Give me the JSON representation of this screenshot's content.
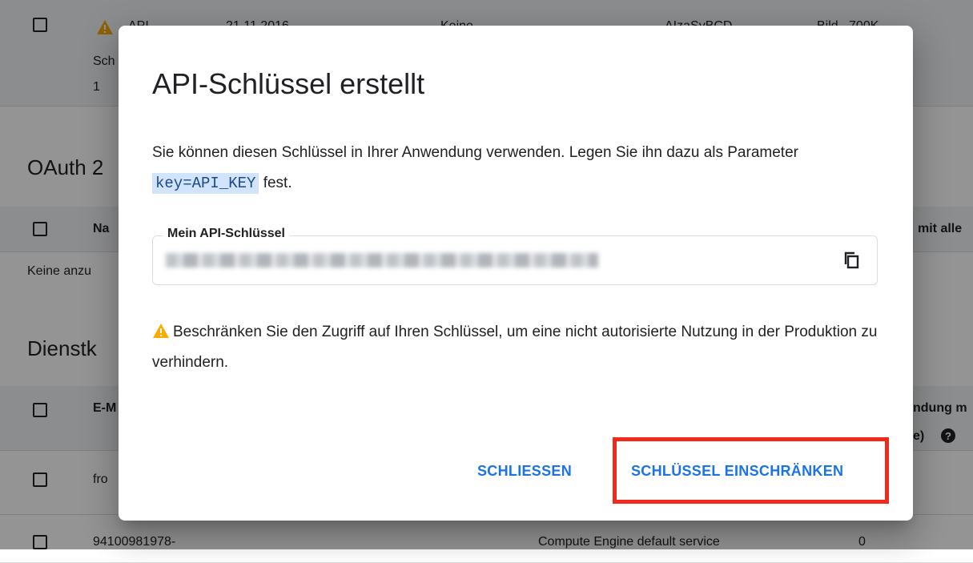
{
  "background": {
    "row1": {
      "col_name_top": "API-",
      "col_name_mid": "Sch",
      "col_name_bot": "1",
      "col_date": "21.11.2016",
      "col_restr": "Keine",
      "col_key": "AIzaSyBCD...",
      "col_tail": "Bild...700K"
    },
    "oauth_heading": "OAuth 2",
    "oauth_header": "Na",
    "oauth_header_right": "mit alle",
    "oauth_empty": "Keine anzu",
    "service_heading": "Dienstk",
    "service_header": "E-M",
    "service_header_right1": "ndung m",
    "service_header_right2": "e)",
    "service_row1": "fro",
    "service_row2_id": "94100981978-",
    "service_row2_name": "Compute Engine default service",
    "service_row2_count": "0"
  },
  "dialog": {
    "title": "API-Schlüssel erstellt",
    "desc_part1": "Sie können diesen Schlüssel in Ihrer Anwendung verwenden. Legen Sie ihn dazu als Parameter",
    "desc_code": "key=API_KEY",
    "desc_part2": "fest.",
    "field_label": "Mein API-Schlüssel",
    "warning_text": "Beschränken Sie den Zugriff auf Ihren Schlüssel, um eine nicht autorisierte Nutzung in der Produktion zu verhindern.",
    "close_label": "SCHLIESSEN",
    "restrict_label": "SCHLÜSSEL EINSCHRÄNKEN"
  },
  "colors": {
    "accent": "#1a73e8",
    "highlight": "#f0291a",
    "warning": "#f9ab00"
  },
  "icons": {
    "copy": "copy-icon",
    "warning": "warning-icon",
    "help": "help-icon"
  }
}
